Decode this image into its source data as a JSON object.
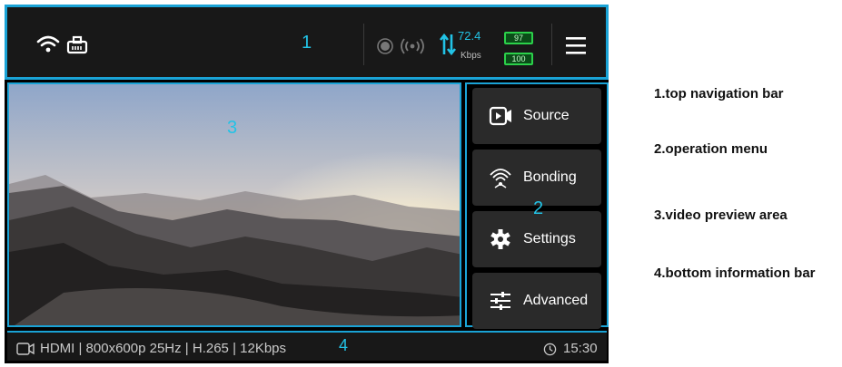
{
  "top_bar": {
    "section_number": "1",
    "bitrate_value": "72.4",
    "bitrate_unit": "Kbps",
    "battery_1": "97",
    "battery_2": "100"
  },
  "operation_menu": {
    "section_number": "2",
    "items": [
      {
        "label": "Source",
        "icon": "video-source-icon"
      },
      {
        "label": "Bonding",
        "icon": "bonding-signal-icon"
      },
      {
        "label": "Settings",
        "icon": "gear-icon"
      },
      {
        "label": "Advanced",
        "icon": "sliders-icon"
      }
    ]
  },
  "video_preview": {
    "section_number": "3"
  },
  "bottom_bar": {
    "section_number": "4",
    "info": "HDMI | 800x600p 25Hz | H.265 | 12Kbps",
    "time": "15:30"
  },
  "legend": [
    "1.top navigation bar",
    "2.operation menu",
    "3.video preview area",
    "4.bottom information bar"
  ],
  "colors": {
    "accent": "#1aa3d6",
    "battery": "#2bd14a",
    "panel": "#2a2a2a"
  }
}
